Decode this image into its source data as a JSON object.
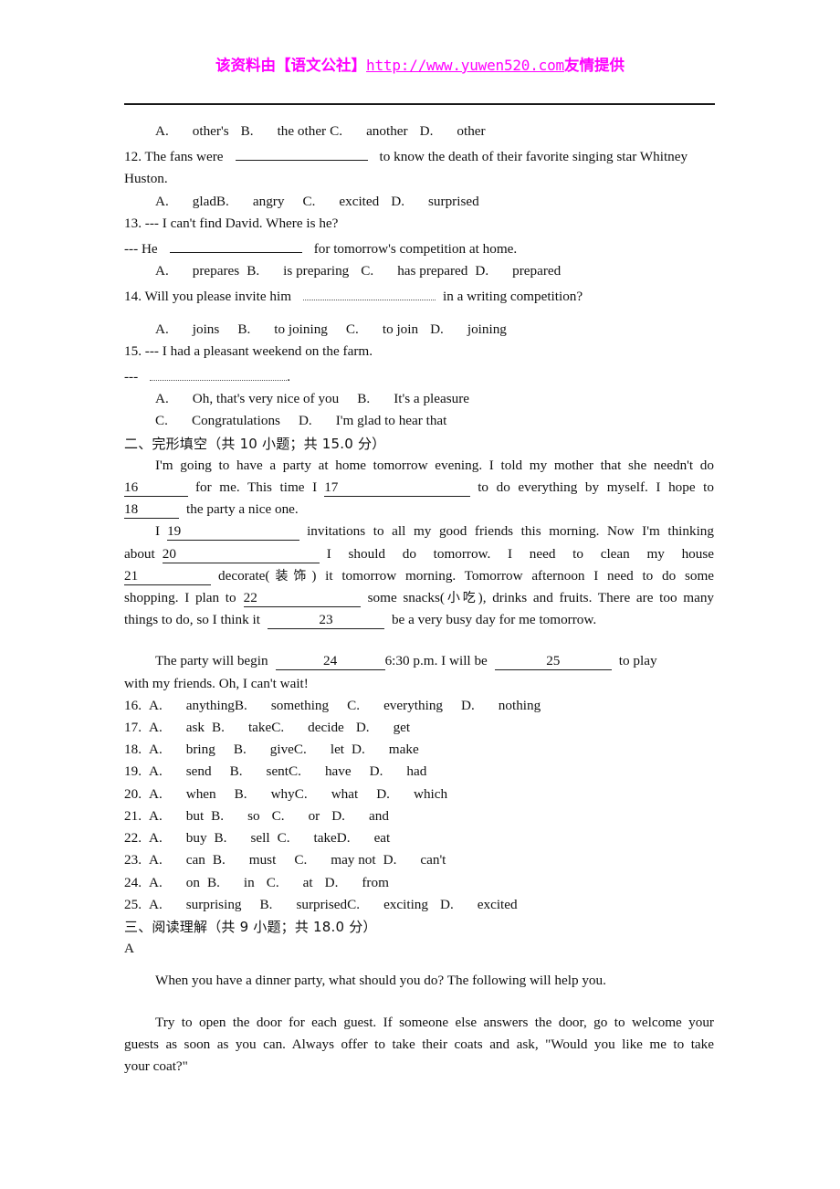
{
  "watermark": {
    "prefix": "该资料由【语文公社】",
    "url": "http://www.yuwen520.com",
    "suffix": "友情提供"
  },
  "q11_options": {
    "a_label": "A.",
    "a_text": "other's",
    "b_label": "B.",
    "b_text": "the other",
    "c_label": "C.",
    "c_text": "another",
    "d_label": "D.",
    "d_text": "other"
  },
  "q12": {
    "stem_pre": "12. The fans were",
    "stem_post": "to know the death of their favorite singing star Whitney",
    "stem_line2": "Huston.",
    "a_label": "A.",
    "a_text": "glad",
    "b_label": "B.",
    "b_text": "angry",
    "c_label": "C.",
    "c_text": "excited",
    "d_label": "D.",
    "d_text": "surprised"
  },
  "q13": {
    "stem_line1": "13. --- I can't find David. Where is he?",
    "stem_pre": "--- He",
    "stem_post": "for tomorrow's competition at home.",
    "a_label": "A.",
    "a_text": "prepares",
    "b_label": "B.",
    "b_text": "is preparing",
    "c_label": "C.",
    "c_text": "has prepared",
    "d_label": "D.",
    "d_text": "prepared"
  },
  "q14": {
    "stem_pre": "14. Will you please invite him",
    "stem_post": "in a writing competition?",
    "a_label": "A.",
    "a_text": "joins",
    "b_label": "B.",
    "b_text": "to joining",
    "c_label": "C.",
    "c_text": "to join",
    "d_label": "D.",
    "d_text": "joining"
  },
  "q15": {
    "stem_line1": "15. --- I had a pleasant weekend on the farm.",
    "stem_pre": "---",
    "stem_post": ".",
    "a_label": "A.",
    "a_text": "Oh, that's very nice of you",
    "b_label": "B.",
    "b_text": "It's a pleasure",
    "c_label": "C.",
    "c_text": "Congratulations",
    "d_label": "D.",
    "d_text": "I'm glad to hear that"
  },
  "section2": {
    "heading": "二、完形填空（共 10 小题；共 15.0 分）",
    "p1_a": "I'm going to have a party at home tomorrow evening. I told my mother that she needn't do",
    "blank16": "16",
    "p1_b": "for me. This time I",
    "blank17": "17",
    "p1_c": "to do everything by myself. I hope to",
    "blank18": "18",
    "p1_d": "the party a nice one.",
    "p2_a": "I",
    "blank19": "19",
    "p2_b": "invitations to all my good friends this morning. Now I'm thinking",
    "p2_c": "about",
    "blank20": "20",
    "p2_d": "I should do tomorrow. I need to clean my house",
    "blank21": "21",
    "p2_e": "decorate(",
    "p2_e_cn": "装饰",
    "p2_e2": ") it tomorrow morning. Tomorrow afternoon I need to do some",
    "p2_f": "shopping. I plan to",
    "blank22": "22",
    "p2_g": "some snacks(",
    "p2_g_cn": "小吃",
    "p2_g2": "), drinks and fruits. There are too many",
    "p2_h": "things to do, so I think it",
    "blank23": "23",
    "p2_i": "be a very busy day for me tomorrow.",
    "p3_a": "The party will begin",
    "blank24": "24",
    "p3_b": "6:30 p.m. I will be",
    "blank25": "25",
    "p3_c": "to play",
    "p3_d": "with my friends. Oh, I can't wait!"
  },
  "cloze_options": [
    {
      "num": "16.",
      "a_label": "A.",
      "a_text": "anything",
      "b_label": "B.",
      "b_text": "something",
      "c_label": "C.",
      "c_text": "everything",
      "d_label": "D.",
      "d_text": "nothing"
    },
    {
      "num": "17.",
      "a_label": "A.",
      "a_text": "ask",
      "b_label": "B.",
      "b_text": "take",
      "c_label": "C.",
      "c_text": "decide",
      "d_label": "D.",
      "d_text": "get"
    },
    {
      "num": "18.",
      "a_label": "A.",
      "a_text": "bring",
      "b_label": "B.",
      "b_text": "give",
      "c_label": "C.",
      "c_text": "let",
      "d_label": "D.",
      "d_text": "make"
    },
    {
      "num": "19.",
      "a_label": "A.",
      "a_text": "send",
      "b_label": "B.",
      "b_text": "sent",
      "c_label": "C.",
      "c_text": "have",
      "d_label": "D.",
      "d_text": "had"
    },
    {
      "num": "20.",
      "a_label": "A.",
      "a_text": "when",
      "b_label": "B.",
      "b_text": "why",
      "c_label": "C.",
      "c_text": "what",
      "d_label": "D.",
      "d_text": "which"
    },
    {
      "num": "21.",
      "a_label": "A.",
      "a_text": "but",
      "b_label": "B.",
      "b_text": "so",
      "c_label": "C.",
      "c_text": "or",
      "d_label": "D.",
      "d_text": "and"
    },
    {
      "num": "22.",
      "a_label": "A.",
      "a_text": "buy",
      "b_label": "B.",
      "b_text": "sell",
      "c_label": "C.",
      "c_text": "take",
      "d_label": "D.",
      "d_text": "eat"
    },
    {
      "num": "23.",
      "a_label": "A.",
      "a_text": "can",
      "b_label": "B.",
      "b_text": "must",
      "c_label": "C.",
      "c_text": "may not",
      "d_label": "D.",
      "d_text": "can't"
    },
    {
      "num": "24.",
      "a_label": "A.",
      "a_text": "on",
      "b_label": "B.",
      "b_text": "in",
      "c_label": "C.",
      "c_text": "at",
      "d_label": "D.",
      "d_text": "from"
    },
    {
      "num": "25.",
      "a_label": "A.",
      "a_text": "surprising",
      "b_label": "B.",
      "b_text": "surprised",
      "c_label": "C.",
      "c_text": "exciting",
      "d_label": "D.",
      "d_text": "excited"
    }
  ],
  "section3": {
    "heading": "三、阅读理解（共 9 小题；共 18.0 分）",
    "passage_label": "A",
    "p1": "When you have a dinner party, what should you do? The following will help you.",
    "p2_line1": "Try to open the door for each guest. If someone else answers the door, go to welcome your",
    "p2_line2": "guests as soon as you can. Always offer to take their coats and ask, \"Would you like me to take",
    "p2_line3": "your coat?\""
  }
}
